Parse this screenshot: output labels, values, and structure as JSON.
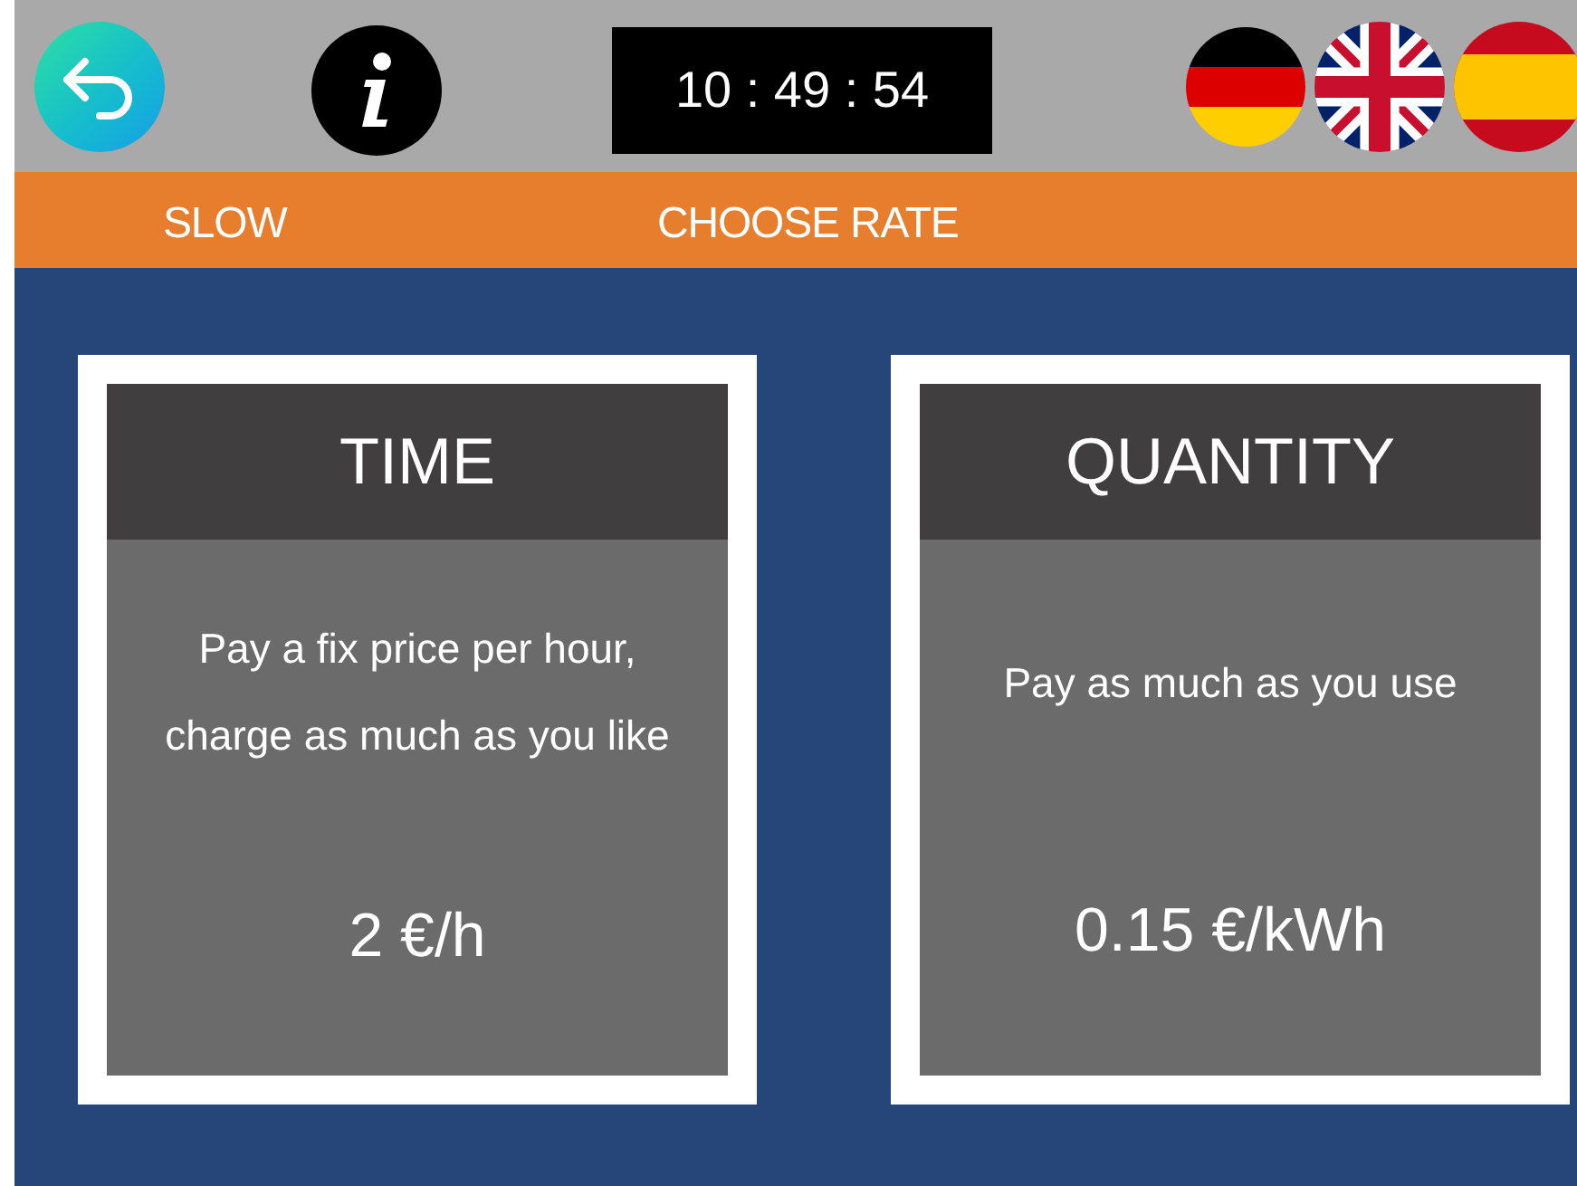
{
  "top_bar": {
    "clock": "10 : 49 : 54"
  },
  "rate_bar": {
    "speed": "SLOW",
    "title": "CHOOSE RATE"
  },
  "rates": [
    {
      "title": "TIME",
      "description": "Pay a fix price per hour, charge as much as you like",
      "price": "2 €/h"
    },
    {
      "title": "QUANTITY",
      "description": "Pay as much as you use",
      "price": "0.15 €/kWh"
    }
  ]
}
